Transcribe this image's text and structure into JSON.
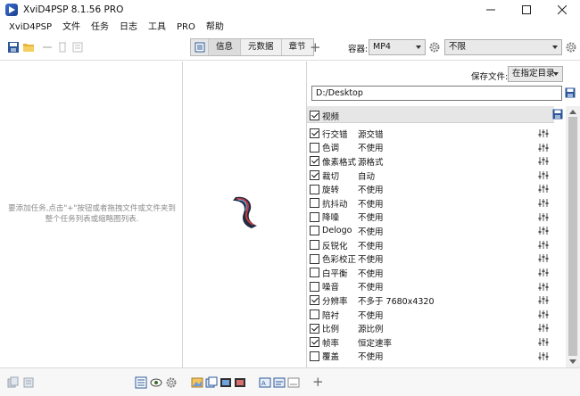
{
  "window": {
    "title": "XviD4PSP 8.1.56 PRO"
  },
  "menu": [
    "XviD4PSP",
    "文件",
    "任务",
    "日志",
    "工具",
    "PRO",
    "帮助"
  ],
  "toolbar": {
    "tabs": [
      "信息",
      "元数据",
      "章节"
    ],
    "container_label": "容器:",
    "container_value": "MP4",
    "limit_value": "不限"
  },
  "left_pane": {
    "empty_message": "要添加任务,点击\"+\"按钮或者拖拽文件或文件夹到整个任务列表或缩略图列表."
  },
  "right_pane": {
    "save_label": "保存文件:",
    "save_mode": "在指定目录",
    "save_path": "D:/Desktop",
    "section_label": "视频",
    "section_checked": true,
    "filters": [
      {
        "name": "行交错",
        "value": "源交错",
        "checked": true
      },
      {
        "name": "色调",
        "value": "不使用",
        "checked": false
      },
      {
        "name": "像素格式",
        "value": "源格式",
        "checked": true
      },
      {
        "name": "裁切",
        "value": "自动",
        "checked": true
      },
      {
        "name": "旋转",
        "value": "不使用",
        "checked": false
      },
      {
        "name": "抗抖动",
        "value": "不使用",
        "checked": false
      },
      {
        "name": "降噪",
        "value": "不使用",
        "checked": false
      },
      {
        "name": "Delogo",
        "value": "不使用",
        "checked": false
      },
      {
        "name": "反锐化",
        "value": "不使用",
        "checked": false
      },
      {
        "name": "色彩校正",
        "value": "不使用",
        "checked": false
      },
      {
        "name": "白平衡",
        "value": "不使用",
        "checked": false
      },
      {
        "name": "噪音",
        "value": "不使用",
        "checked": false
      },
      {
        "name": "分辨率",
        "value": "不多于 7680x4320",
        "checked": true
      },
      {
        "name": "陪衬",
        "value": "不使用",
        "checked": false
      },
      {
        "name": "比例",
        "value": "源比例",
        "checked": true
      },
      {
        "name": "帧率",
        "value": "恒定速率",
        "checked": true
      },
      {
        "name": "覆盖",
        "value": "不使用",
        "checked": false
      }
    ]
  },
  "icons": {
    "toolbar_left": [
      "save-icon",
      "open-folder-icon",
      "move-icon",
      "delete-icon",
      "list-icon"
    ],
    "bottom": [
      "copy-icon",
      "paste-icon",
      "info-icon",
      "eye-icon",
      "gear-icon",
      "image-icon",
      "image-copy-icon",
      "film-icon",
      "film-add-icon",
      "audio-icon",
      "text-icon",
      "subtitle-icon",
      "add-icon"
    ]
  },
  "colors": {
    "accent": "#2b5797"
  }
}
